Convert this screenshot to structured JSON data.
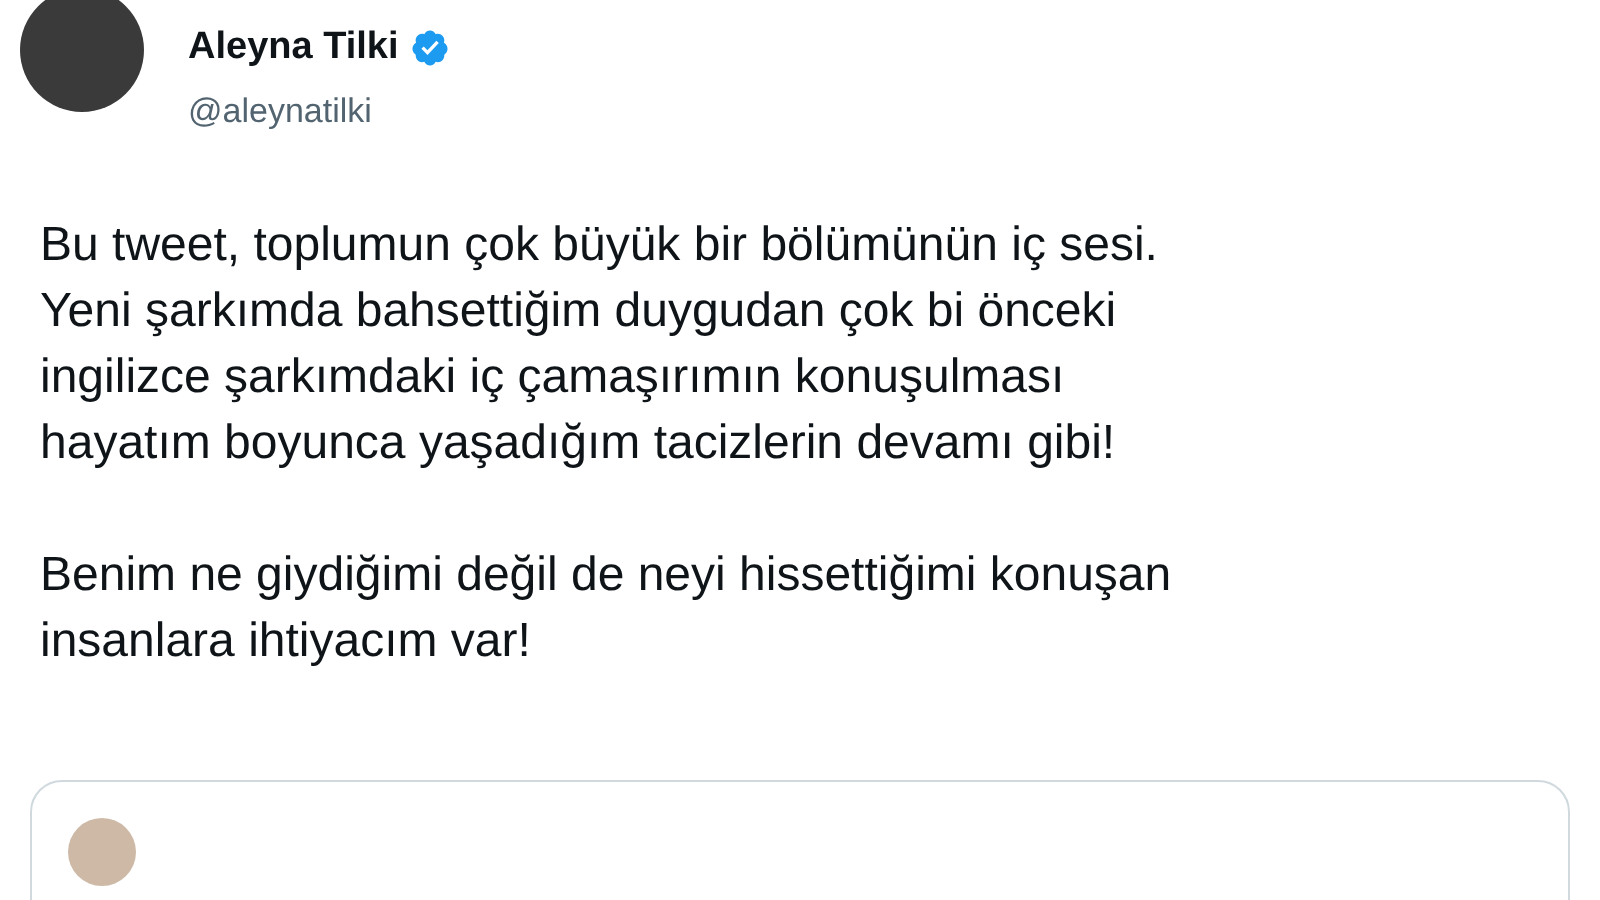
{
  "author": {
    "name": "Aleyna Tilki",
    "handle": "@aleynatilki",
    "verified": true
  },
  "paragraphs": [
    "Bu tweet, toplumun çok büyük bir bölümünün iç sesi.\nYeni şarkımda bahsettiğim duygudan çok bi önceki\ningilizce şarkımdaki iç çamaşırımın konuşulması\nhayatım boyunca yaşadığım tacizlerin devamı gibi!",
    "Benim ne giydiğimi değil de neyi hissettiğimi konuşan\ninsanlara ihtiyacım var!"
  ]
}
